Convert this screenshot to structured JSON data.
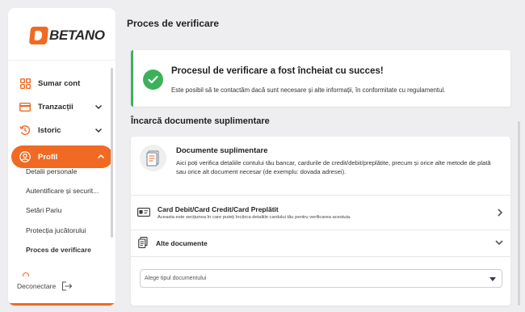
{
  "brand": {
    "logo_text": "BETANO",
    "accent": "#f06a23",
    "success": "#3cb15a"
  },
  "sidebar": {
    "items": [
      {
        "label": "Sumar cont",
        "icon": "grid-icon"
      },
      {
        "label": "Tranzacții",
        "icon": "card-icon"
      },
      {
        "label": "Istoric",
        "icon": "history-icon"
      },
      {
        "label": "Profil",
        "icon": "user-icon"
      }
    ],
    "subitems": [
      {
        "label": "Detalii personale"
      },
      {
        "label": "Autentificare și securit..."
      },
      {
        "label": "Setări Pariu"
      },
      {
        "label": "Protecția jucătorului"
      },
      {
        "label": "Proces de verificare"
      }
    ],
    "logout_label": "Deconectare"
  },
  "main": {
    "title": "Proces de verificare",
    "success": {
      "title": "Procesul de verificare a fost încheiat cu succes!",
      "text": "Este posibil să te contactăm dacă sunt necesare și alte informații, în conformitate cu regulamentul."
    },
    "section_title": "Încarcă documente suplimentare",
    "docs": {
      "title": "Documente suplimentare",
      "description": "Aici poți verifica detaliile contului tău bancar, cardurile de credit/debit/preplătite, precum și orice alte metode de plată sau orice alt document necesar (de exemplu: dovada adresei).",
      "card_row": {
        "title": "Card Debit/Card Credit/Card Preplătit",
        "subtitle": "Aceasta este secțiunea în care puteți încărca detaliile cardului tău pentru verificarea acestuia."
      },
      "other_row": {
        "title": "Alte documente"
      },
      "select_placeholder": "Alege tipul documentului"
    }
  }
}
